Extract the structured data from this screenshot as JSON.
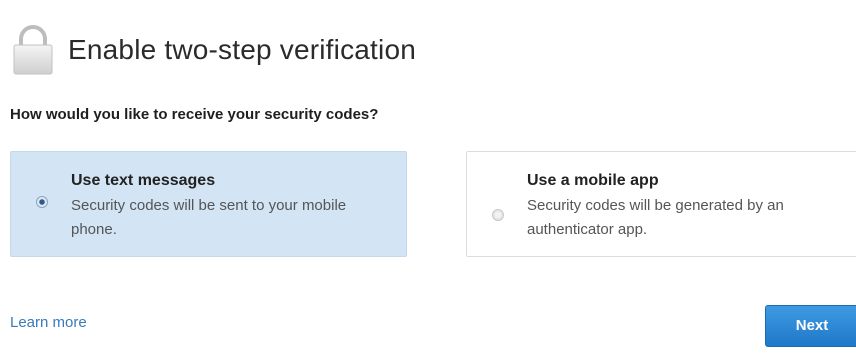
{
  "header": {
    "title": "Enable two-step verification",
    "icon": "lock-icon"
  },
  "question": "How would you like to receive your security codes?",
  "options": [
    {
      "title": "Use text messages",
      "description": "Security codes will be sent to your mobile phone.",
      "selected": true
    },
    {
      "title": "Use a mobile app",
      "description": "Security codes will be generated by an authenticator app.",
      "selected": false
    }
  ],
  "footer": {
    "learn_more": "Learn more",
    "next_label": "Next"
  },
  "colors": {
    "selected_bg": "#d3e4f5",
    "link": "#3a7ab8",
    "button": "#2b86d6"
  }
}
